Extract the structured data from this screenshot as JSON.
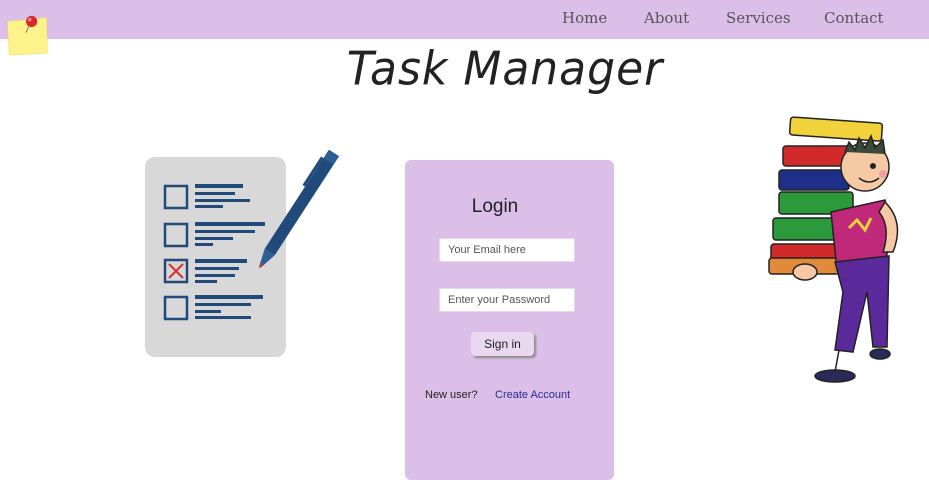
{
  "nav": {
    "items": [
      {
        "label": "Home"
      },
      {
        "label": "About"
      },
      {
        "label": "Services"
      },
      {
        "label": "Contact"
      }
    ]
  },
  "header": {
    "title": "Task Manager"
  },
  "login": {
    "title": "Login",
    "email_placeholder": "Your Email here",
    "password_placeholder": "Enter your Password",
    "signin_label": "Sign in",
    "new_user_label": "New user?",
    "create_account_label": "Create Account"
  },
  "colors": {
    "nav_bg": "#dcbfe8",
    "panel_bg": "#dcbfe8",
    "checklist_blue": "#1f4a7a",
    "accent_red": "#d93030"
  },
  "icons": {
    "logo": "sticky-note-pin-icon",
    "checklist": "checklist-pen-illustration",
    "mascot": "boy-carrying-books-illustration"
  }
}
